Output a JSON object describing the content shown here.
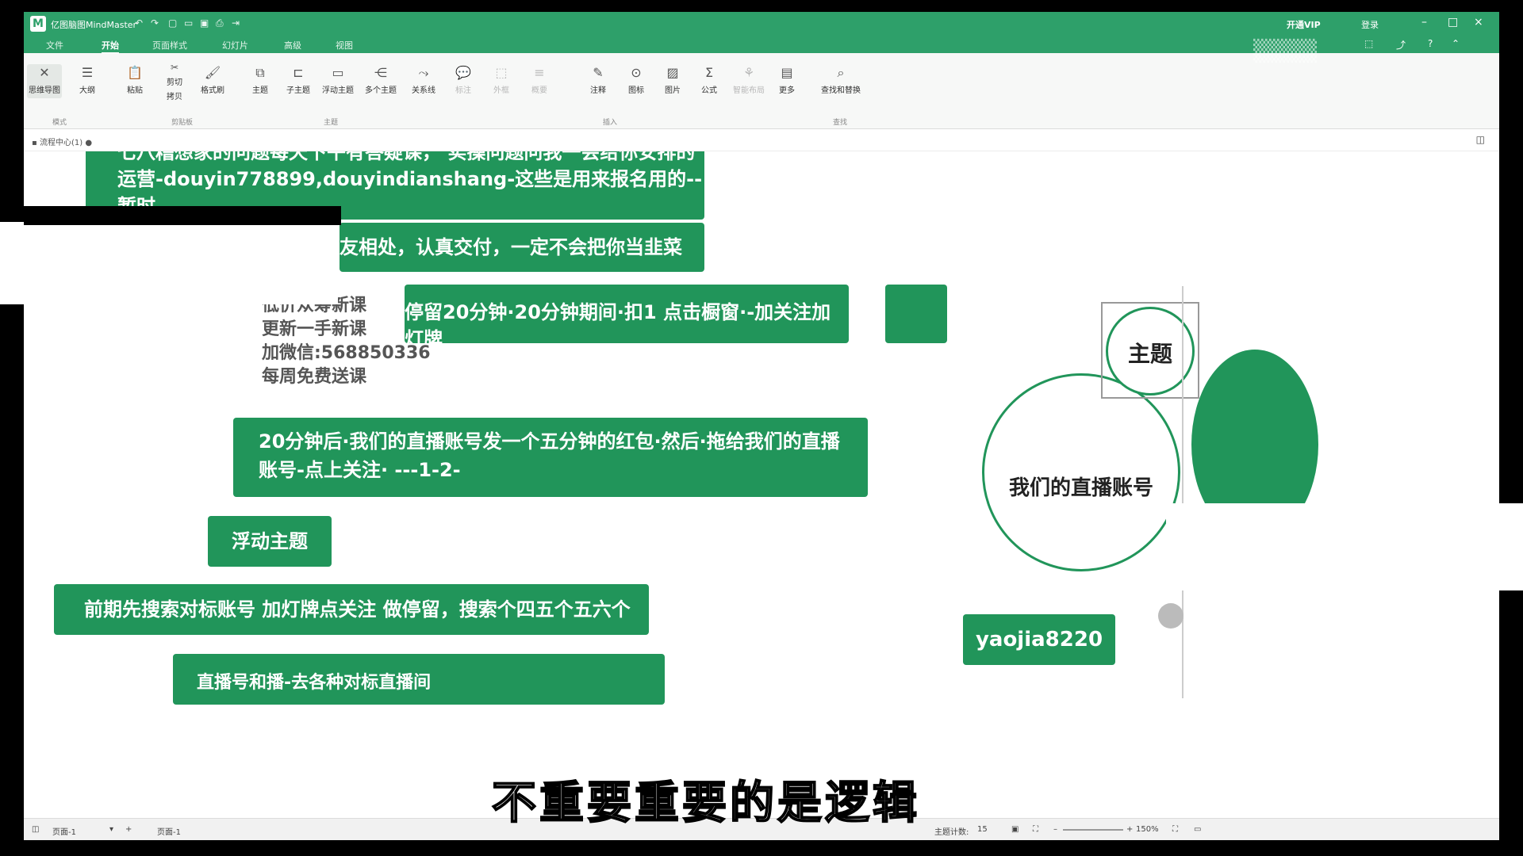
{
  "titlebar": {
    "app_title": "亿图脑图MindMaster",
    "vip": "开通VIP",
    "login": "登录",
    "logo_icon": "mindmaster-logo-icon"
  },
  "menu_tabs": [
    "文件",
    "开始",
    "页面样式",
    "幻灯片",
    "高级",
    "视图"
  ],
  "ribbon": {
    "buttons": [
      {
        "label": "思维导图",
        "icon": "mindmap-icon"
      },
      {
        "label": "大纲",
        "icon": "outline-icon"
      },
      {
        "label": "粘贴",
        "icon": "paste-icon"
      },
      {
        "label": "剪切",
        "icon": "cut-icon"
      },
      {
        "label": "拷贝",
        "icon": "copy-icon"
      },
      {
        "label": "格式刷",
        "icon": "format-brush-icon"
      },
      {
        "label": "主题",
        "icon": "topic-icon"
      },
      {
        "label": "子主题",
        "icon": "subtopic-icon"
      },
      {
        "label": "浮动主题",
        "icon": "floating-topic-icon"
      },
      {
        "label": "多个主题",
        "icon": "multi-topic-icon"
      },
      {
        "label": "关系线",
        "icon": "relation-line-icon"
      },
      {
        "label": "标注",
        "icon": "callout-icon"
      },
      {
        "label": "外框",
        "icon": "boundary-icon"
      },
      {
        "label": "概要",
        "icon": "summary-icon"
      },
      {
        "label": "注释",
        "icon": "note-icon"
      },
      {
        "label": "图标",
        "icon": "mark-icon"
      },
      {
        "label": "图片",
        "icon": "picture-icon"
      },
      {
        "label": "公式",
        "icon": "formula-icon"
      },
      {
        "label": "智能布局",
        "icon": "smart-layout-icon"
      },
      {
        "label": "更多",
        "icon": "more-icon"
      },
      {
        "label": "查找和替换",
        "icon": "find-replace-icon"
      }
    ],
    "groups": [
      "模式",
      "剪贴板",
      "主题",
      "插入",
      "查找"
    ]
  },
  "doc_tab": "流程中心(1)",
  "canvas": {
    "node1": "七八糟想家的问题每天下午有答疑课， 实操问题问我一会给你安排的\n运营-douyin778899,douyindianshang-这些是用来报名用的--暂时\n不实操的，告诉运营，我暂时不实操，实操时候告诉开始计算时间。",
    "node2": "友相处，认真交付，一定不会把你当韭菜",
    "ad_text": "低价众筹新课\n更新一手新课\n加微信:568850336\n每周免费送课",
    "node3": "停留20分钟·20分钟期间·扣1 点击橱窗·-加关注加灯牌",
    "node4": "20分钟后·我们的直播账号发一个五分钟的红包·然后·拖给我们的直播\n账号-点上关注· ---1-2-",
    "node5": "浮动主题",
    "node6": "前期先搜索对标账号 加灯牌点关注 做停留，搜索个四五个五六个",
    "node7": "直播号和播-去各种对标直播间",
    "node8": "yaojia8220",
    "circle_main": "主题",
    "circle_live": "我们的直播账号"
  },
  "statusbar": {
    "page_nav": "页面-1",
    "page_tab": "页面-1",
    "topic_count_label": "主题计数:",
    "topic_count": "15",
    "zoom": "150%"
  },
  "overlay": {
    "subtitle": "不重要重要的是逻辑"
  },
  "colors": {
    "accent": "#2ea06a",
    "node_green": "#21955a"
  }
}
